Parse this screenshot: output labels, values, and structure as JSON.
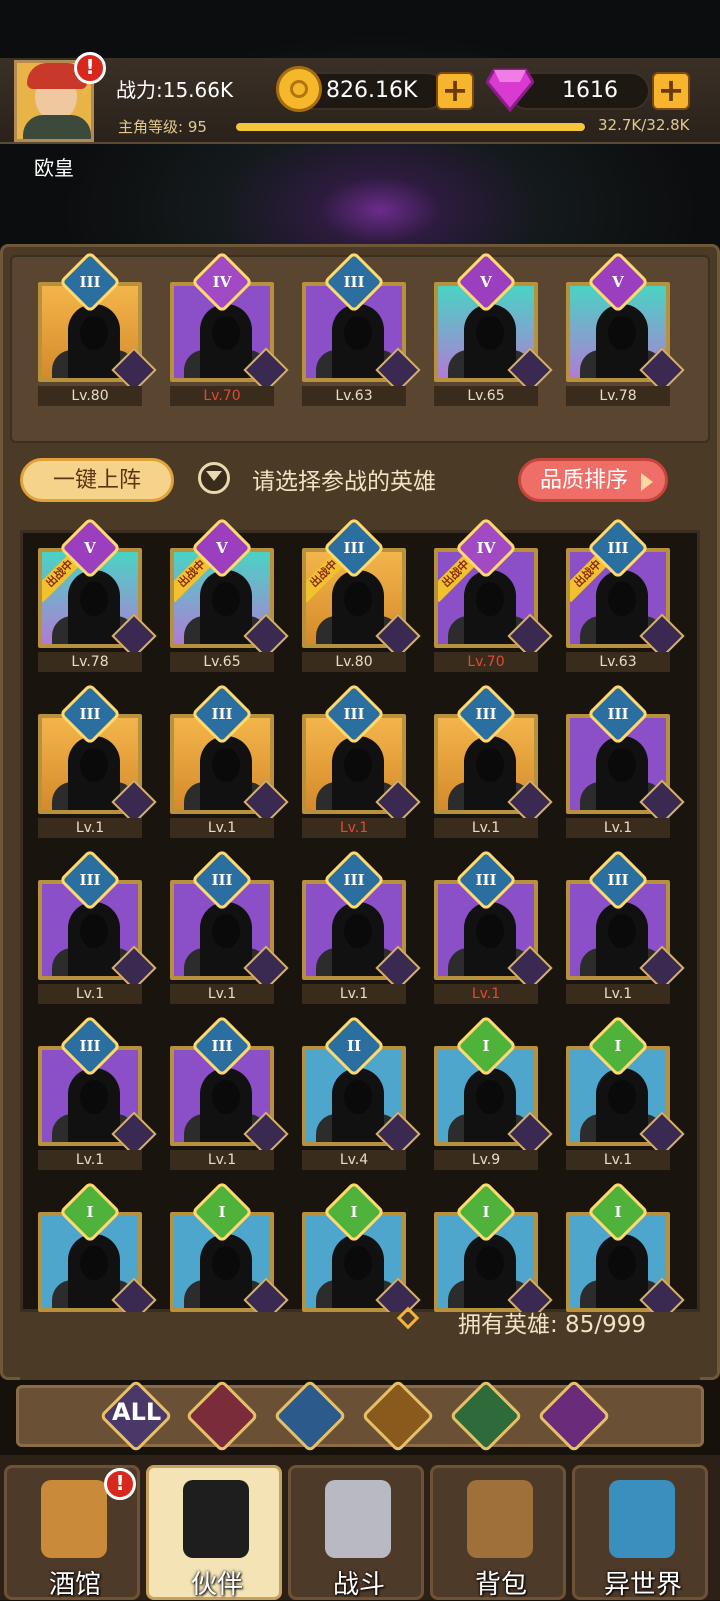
{
  "player": {
    "name": "欧皇",
    "power_label": "战力:15.66K",
    "level_label": "主角等级: 95",
    "exp_text": "32.7K/32.8K",
    "exp_fraction": 0.997
  },
  "resources": {
    "gold": "826.16K",
    "gems": "1616"
  },
  "team": [
    {
      "tier": "III",
      "level": "Lv.80",
      "bg": "gold",
      "red": false
    },
    {
      "tier": "IV",
      "level": "Lv.70",
      "bg": "purple",
      "red": true
    },
    {
      "tier": "III",
      "level": "Lv.63",
      "bg": "purple",
      "red": false
    },
    {
      "tier": "V",
      "level": "Lv.65",
      "bg": "teal",
      "red": false
    },
    {
      "tier": "V",
      "level": "Lv.78",
      "bg": "teal",
      "red": false
    }
  ],
  "controls": {
    "auto_deploy": "一键上阵",
    "prompt": "请选择参战的英雄",
    "sort": "品质排序"
  },
  "deployed_ribbon": "出战中",
  "roster": [
    {
      "tier": "V",
      "level": "Lv.78",
      "bg": "teal",
      "deployed": true,
      "red": false
    },
    {
      "tier": "V",
      "level": "Lv.65",
      "bg": "teal",
      "deployed": true,
      "red": false
    },
    {
      "tier": "III",
      "level": "Lv.80",
      "bg": "gold",
      "deployed": true,
      "red": false
    },
    {
      "tier": "IV",
      "level": "Lv.70",
      "bg": "purple",
      "deployed": true,
      "red": true
    },
    {
      "tier": "III",
      "level": "Lv.63",
      "bg": "purple",
      "deployed": true,
      "red": false
    },
    {
      "tier": "III",
      "level": "Lv.1",
      "bg": "gold",
      "deployed": false,
      "red": false
    },
    {
      "tier": "III",
      "level": "Lv.1",
      "bg": "gold",
      "deployed": false,
      "red": false
    },
    {
      "tier": "III",
      "level": "Lv.1",
      "bg": "gold",
      "deployed": false,
      "red": true
    },
    {
      "tier": "III",
      "level": "Lv.1",
      "bg": "gold",
      "deployed": false,
      "red": false
    },
    {
      "tier": "III",
      "level": "Lv.1",
      "bg": "purple",
      "deployed": false,
      "red": false
    },
    {
      "tier": "III",
      "level": "Lv.1",
      "bg": "purple",
      "deployed": false,
      "red": false
    },
    {
      "tier": "III",
      "level": "Lv.1",
      "bg": "purple",
      "deployed": false,
      "red": false
    },
    {
      "tier": "III",
      "level": "Lv.1",
      "bg": "purple",
      "deployed": false,
      "red": false
    },
    {
      "tier": "III",
      "level": "Lv.1",
      "bg": "purple",
      "deployed": false,
      "red": true
    },
    {
      "tier": "III",
      "level": "Lv.1",
      "bg": "purple",
      "deployed": false,
      "red": false
    },
    {
      "tier": "III",
      "level": "Lv.1",
      "bg": "purple",
      "deployed": false,
      "red": false
    },
    {
      "tier": "III",
      "level": "Lv.1",
      "bg": "purple",
      "deployed": false,
      "red": false
    },
    {
      "tier": "II",
      "level": "Lv.4",
      "bg": "blue",
      "deployed": false,
      "red": false
    },
    {
      "tier": "I",
      "level": "Lv.9",
      "bg": "blue",
      "deployed": false,
      "red": false
    },
    {
      "tier": "I",
      "level": "Lv.1",
      "bg": "blue",
      "deployed": false,
      "red": false
    },
    {
      "tier": "I",
      "level": "",
      "bg": "blue",
      "deployed": false,
      "red": false
    },
    {
      "tier": "I",
      "level": "",
      "bg": "blue",
      "deployed": false,
      "red": false
    },
    {
      "tier": "I",
      "level": "",
      "bg": "blue",
      "deployed": false,
      "red": false
    },
    {
      "tier": "I",
      "level": "",
      "bg": "blue",
      "deployed": false,
      "red": false
    },
    {
      "tier": "I",
      "level": "",
      "bg": "blue",
      "deployed": false,
      "red": false
    }
  ],
  "owned": "拥有英雄: 85/999",
  "filters": {
    "all_label": "ALL",
    "icons": [
      "elf-helm-icon",
      "fish-icon",
      "lion-icon",
      "elf-face-icon",
      "demon-face-icon"
    ]
  },
  "nav": [
    {
      "label": "酒馆",
      "icon": "beer-mug-icon",
      "active": false,
      "alert": true
    },
    {
      "label": "伙伴",
      "icon": "partner-icon",
      "active": true,
      "alert": false
    },
    {
      "label": "战斗",
      "icon": "crossed-swords-icon",
      "active": false,
      "alert": false
    },
    {
      "label": "背包",
      "icon": "backpack-icon",
      "active": false,
      "alert": false
    },
    {
      "label": "异世界",
      "icon": "portal-icon",
      "active": false,
      "alert": false
    }
  ],
  "colors": {
    "gold_card": "#f3b54b",
    "purple_card": "#8b4fc8",
    "blue_card": "#4fa6cd",
    "red_level": "#e04a33",
    "accent_orange": "#f7b42d"
  }
}
